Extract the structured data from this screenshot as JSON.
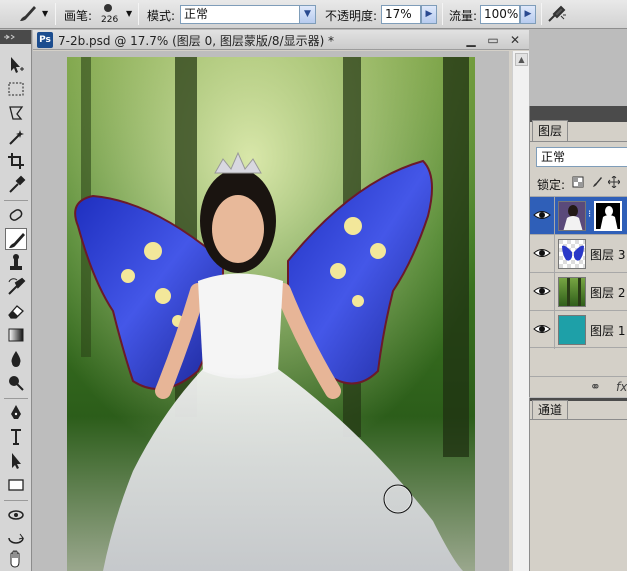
{
  "options_bar": {
    "brush_label": "画笔:",
    "brush_size": "226",
    "mode_label": "模式:",
    "mode_value": "正常",
    "opacity_label": "不透明度:",
    "opacity_value": "17%",
    "flow_label": "流量:",
    "flow_value": "100%"
  },
  "document": {
    "title": "7-2b.psd @ 17.7% (图层 0, 图层蒙版/8/显示器) *",
    "minimize": "▁",
    "restore": "▭",
    "close": "✕",
    "ps_badge": "Ps"
  },
  "layers_panel": {
    "tab": "图层",
    "blend_mode": "正常",
    "lock_label": "锁定:",
    "footer_icon": "fx",
    "layers": [
      {
        "name": "",
        "selected": true,
        "thumb": "bride-with-mask"
      },
      {
        "name": "图层 3",
        "selected": false,
        "thumb": "butterfly-wings"
      },
      {
        "name": "图层 2",
        "selected": false,
        "thumb": "forest"
      },
      {
        "name": "图层 1",
        "selected": false,
        "thumb": "teal-fill"
      }
    ]
  },
  "channels_panel": {
    "tab": "通道"
  },
  "colors": {
    "selected_layer": "#2f5fb8",
    "teal_fill": "#1ea0a8"
  }
}
